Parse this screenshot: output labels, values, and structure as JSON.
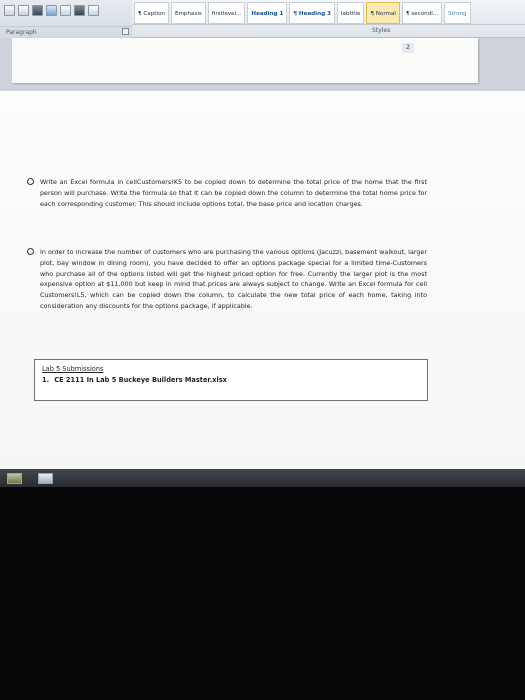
{
  "ribbon": {
    "paragraph_group_label": "Paragraph",
    "styles_group_label": "Styles",
    "styles": [
      {
        "label": "¶ Caption",
        "kind": "normal"
      },
      {
        "label": "Emphasis",
        "kind": "normal"
      },
      {
        "label": "firstlevel...",
        "kind": "normal"
      },
      {
        "label": "Heading 1",
        "kind": "heading"
      },
      {
        "label": "¶ Heading 3",
        "kind": "heading"
      },
      {
        "label": "labtitle",
        "kind": "normal"
      },
      {
        "label": "¶ Normal",
        "kind": "selected"
      },
      {
        "label": "¶ secondl...",
        "kind": "normal"
      },
      {
        "label": "Strong",
        "kind": "sub"
      }
    ]
  },
  "document": {
    "page_number": "2",
    "paragraphs": [
      "Write an Excel formula in cellCustomers!K5 to be copied down to determine the total price of the home that the first person will purchase. Write the formula so that it can be copied down the column to determine the total home price for each corresponding customer. This should include options total, the base price and location charges.",
      "In order to increase the number of customers who are purchasing the various options (Jacuzzi, basement walkout, larger plot, bay window in dining room), you have decided to offer an options package special for a limited time-Customers who purchase all of the options listed will get the highest priced option for free. Currently the larger plot is the most expensive option at $11,000 but keep in mind that prices are always subject to change. Write an Excel formula for cell Customers!L5, which can be copied down the column, to calculate the new total price of each home, taking into consideration any discounts for the options package, if applicable."
    ],
    "submissions": {
      "heading": "Lab 5 Submissions",
      "items": [
        {
          "number": "1.",
          "text": "CE 2111 In Lab 5 Buckeye Builders Master.xlsx"
        }
      ]
    }
  }
}
